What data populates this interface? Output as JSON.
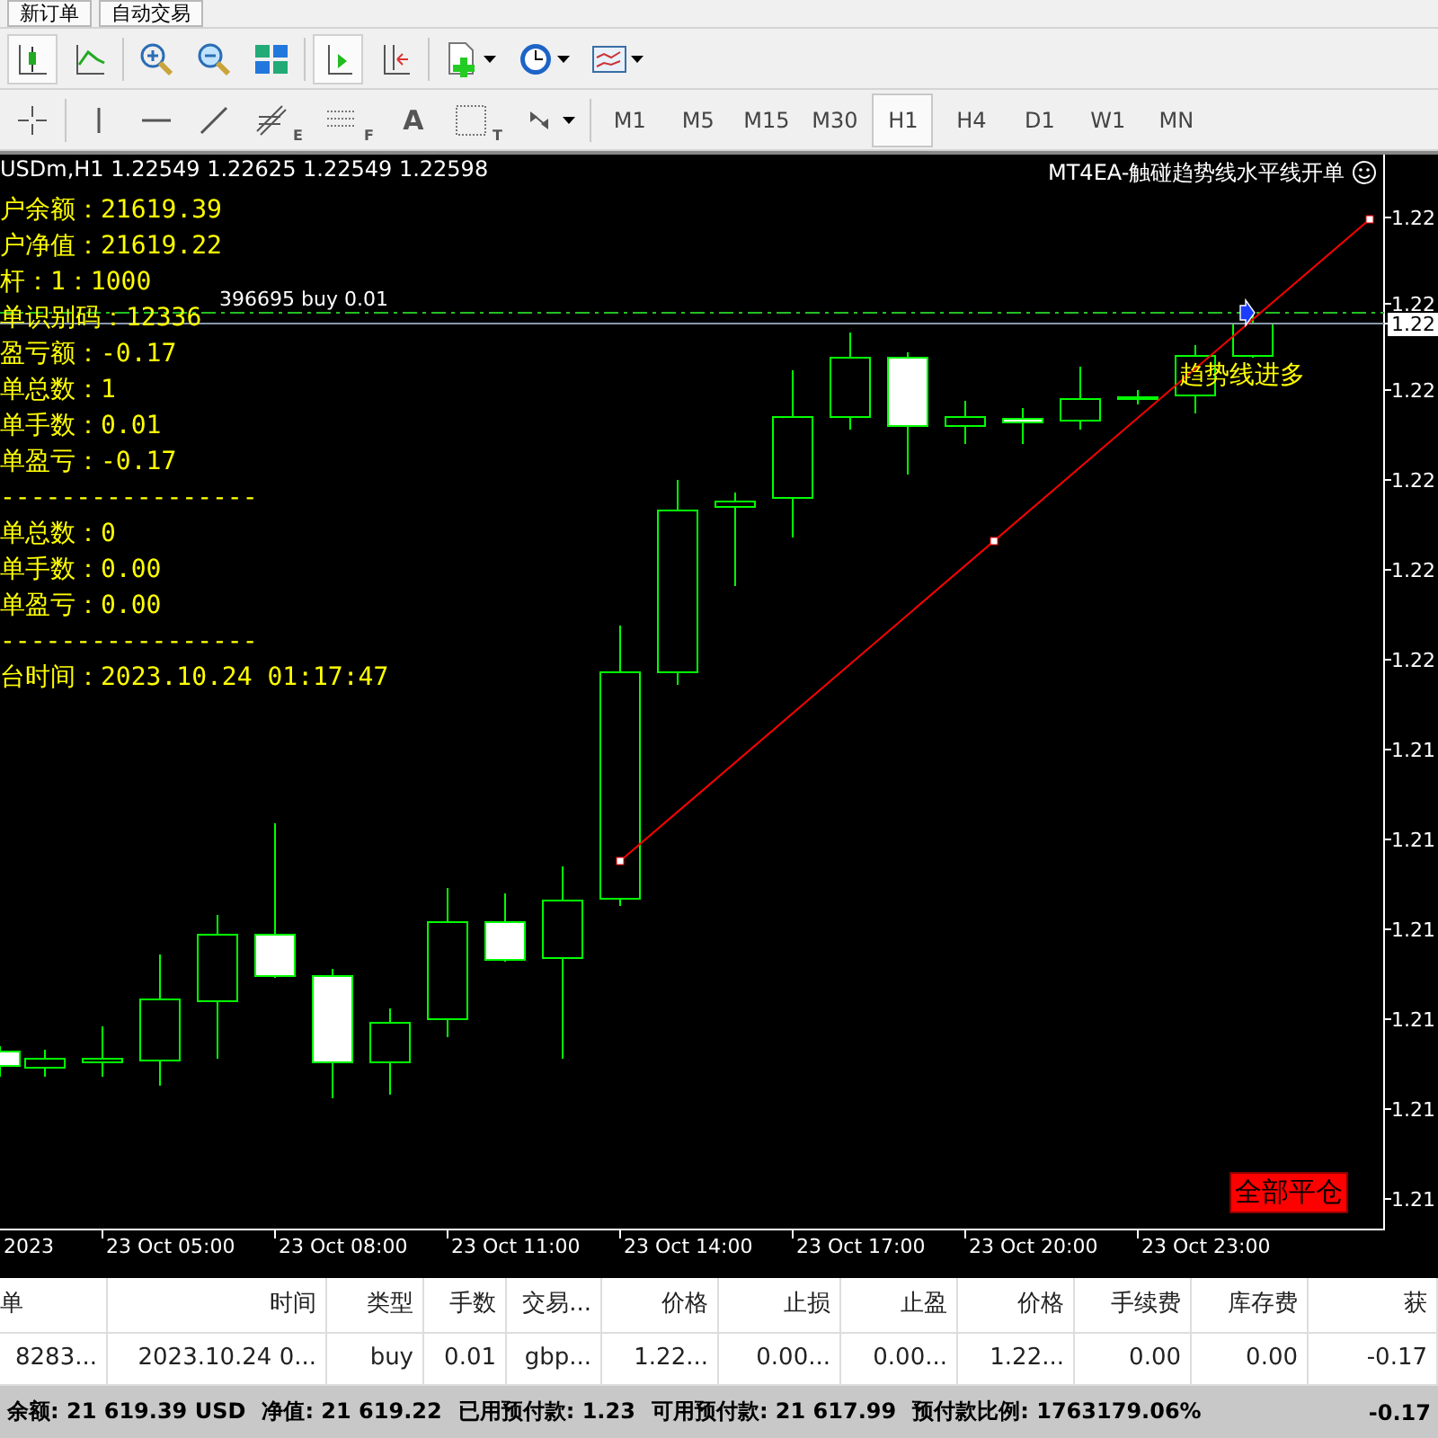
{
  "top_toolbar": {
    "buttons": [
      {
        "label": "新订单"
      },
      {
        "label": "自动交易"
      }
    ]
  },
  "chart_toolbar": [
    {
      "kind": "candles",
      "selected": true,
      "dropdown": false
    },
    {
      "kind": "line",
      "selected": false,
      "dropdown": false
    },
    {
      "kind": "zoom_in",
      "selected": false,
      "dropdown": false
    },
    {
      "kind": "zoom_out",
      "selected": false,
      "dropdown": false
    },
    {
      "kind": "tile",
      "selected": false,
      "dropdown": false
    },
    {
      "kind": "shift",
      "selected": true,
      "dropdown": false
    },
    {
      "kind": "autoscroll",
      "selected": false,
      "dropdown": false
    },
    {
      "kind": "new_chart",
      "selected": false,
      "dropdown": true
    },
    {
      "kind": "clock",
      "selected": false,
      "dropdown": true
    },
    {
      "kind": "template",
      "selected": false,
      "dropdown": true
    }
  ],
  "drawing_tools": [
    {
      "kind": "crosshair",
      "dropdown": false
    },
    {
      "kind": "vline",
      "dropdown": false
    },
    {
      "kind": "hline",
      "dropdown": false
    },
    {
      "kind": "trend",
      "dropdown": false
    },
    {
      "kind": "fibo",
      "glyph": "E",
      "dropdown": false
    },
    {
      "kind": "fibo_channel",
      "glyph": "F",
      "dropdown": false
    },
    {
      "kind": "text",
      "glyph": "A",
      "dropdown": false
    },
    {
      "kind": "label",
      "glyph": "T",
      "dropdown": false
    },
    {
      "kind": "arrows",
      "dropdown": true
    }
  ],
  "timeframes": [
    {
      "label": "M1",
      "selected": false
    },
    {
      "label": "M5",
      "selected": false
    },
    {
      "label": "M15",
      "selected": false
    },
    {
      "label": "M30",
      "selected": false
    },
    {
      "label": "H1",
      "selected": true
    },
    {
      "label": "H4",
      "selected": false
    },
    {
      "label": "D1",
      "selected": false
    },
    {
      "label": "W1",
      "selected": false
    },
    {
      "label": "MN",
      "selected": false
    }
  ],
  "chart": {
    "symbol": "USDm,H1",
    "ohlc": "1.22549 1.22625 1.22549 1.22598",
    "ea_name": "MT4EA-触碰趋势线水平线开单",
    "info_lines": [
      "户余额：21619.39",
      "户净值：21619.22",
      "杆：1：1000",
      "单识别码：12336",
      "盈亏额：-0.17",
      "单总数：1",
      "单手数：0.01",
      "单盈亏：-0.17",
      "-----------------",
      "单总数：0",
      "单手数：0.00",
      "单盈亏：0.00",
      "-----------------",
      "台时间：2023.10.24 01:17:47"
    ],
    "order_label": "396695 buy 0.01",
    "signal_text": "趋势线进多",
    "close_all_button": "全部平仓",
    "price_labels": [
      {
        "label": "1.22",
        "current": false
      },
      {
        "label": "1.22",
        "current": false
      },
      {
        "label": "1.22",
        "current": true
      },
      {
        "label": "1.22",
        "current": false
      },
      {
        "label": "1.22",
        "current": false
      },
      {
        "label": "1.22",
        "current": false
      },
      {
        "label": "1.22",
        "current": false
      },
      {
        "label": "1.21",
        "current": false
      },
      {
        "label": "1.21",
        "current": false
      },
      {
        "label": "1.21",
        "current": false
      },
      {
        "label": "1.21",
        "current": false
      },
      {
        "label": "1.21",
        "current": false
      },
      {
        "label": "1.21",
        "current": false
      }
    ],
    "time_labels": [
      "2023",
      "23 Oct 05:00",
      "23 Oct 08:00",
      "23 Oct 11:00",
      "23 Oct 14:00",
      "23 Oct 17:00",
      "23 Oct 20:00",
      "23 Oct 23:00"
    ]
  },
  "terminal": {
    "columns": [
      "单",
      "时间",
      "类型",
      "手数",
      "交易...",
      "价格",
      "止损",
      "止盈",
      "价格",
      "手续费",
      "库存费",
      "获"
    ],
    "rows": [
      [
        "8283...",
        "2023.10.24 0...",
        "buy",
        "0.01",
        "gbp...",
        "1.22...",
        "0.00...",
        "0.00...",
        "1.22...",
        "0.00",
        "0.00",
        "-0.17"
      ]
    ],
    "status": [
      "余额: 21 619.39 USD",
      "净值: 21 619.22",
      "已用预付款: 1.23",
      "可用预付款: 21 617.99",
      "预付款比例: 1763179.06%",
      "-0.17"
    ]
  }
}
